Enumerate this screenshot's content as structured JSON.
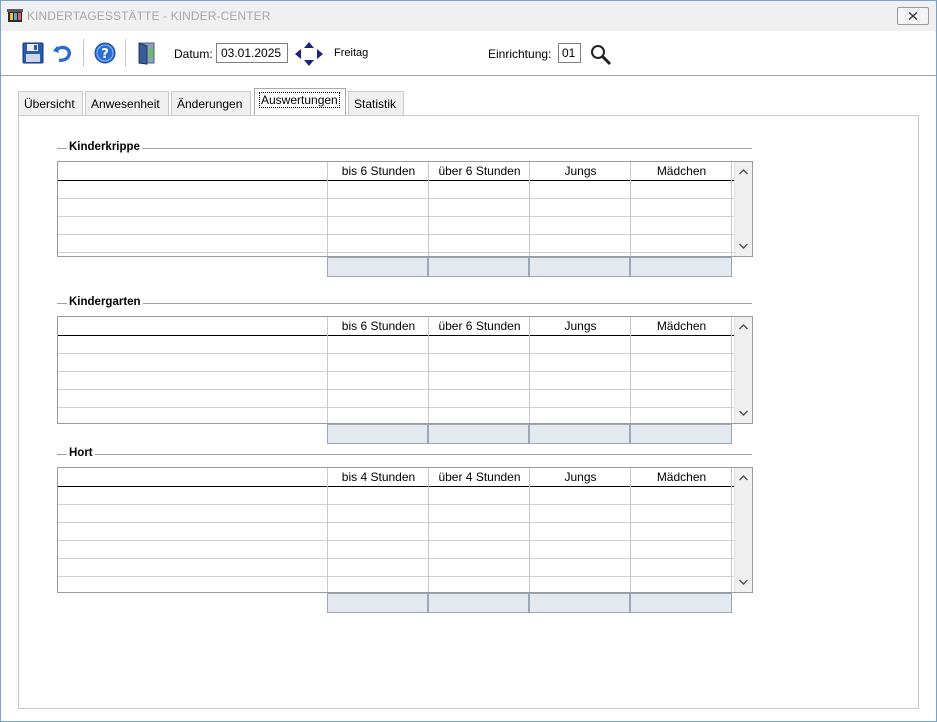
{
  "window": {
    "title": "KINDERTAGESSTÄTTE - KINDER-CENTER"
  },
  "toolbar": {
    "datum_label": "Datum:",
    "datum_value": "03.01.2025",
    "weekday": "Freitag",
    "einrichtung_label": "Einrichtung:",
    "einrichtung_value": "01"
  },
  "tabs": [
    {
      "label": "Übersicht"
    },
    {
      "label": "Anwesenheit"
    },
    {
      "label": "Änderungen"
    },
    {
      "label": "Auswertungen"
    },
    {
      "label": "Statistik"
    }
  ],
  "groups": [
    {
      "title": "Kinderkrippe",
      "columns": [
        "",
        "bis 6 Stunden",
        "über 6 Stunden",
        "Jungs",
        "Mädchen"
      ]
    },
    {
      "title": "Kindergarten",
      "columns": [
        "",
        "bis 6 Stunden",
        "über 6 Stunden",
        "Jungs",
        "Mädchen"
      ]
    },
    {
      "title": "Hort",
      "columns": [
        "",
        "bis 4 Stunden",
        "über 4 Stunden",
        "Jungs",
        "Mädchen"
      ]
    }
  ],
  "colors": {
    "accent": "#1f5fbf",
    "help": "#2b6fd6",
    "sum_fill": "#e4e9f0"
  }
}
